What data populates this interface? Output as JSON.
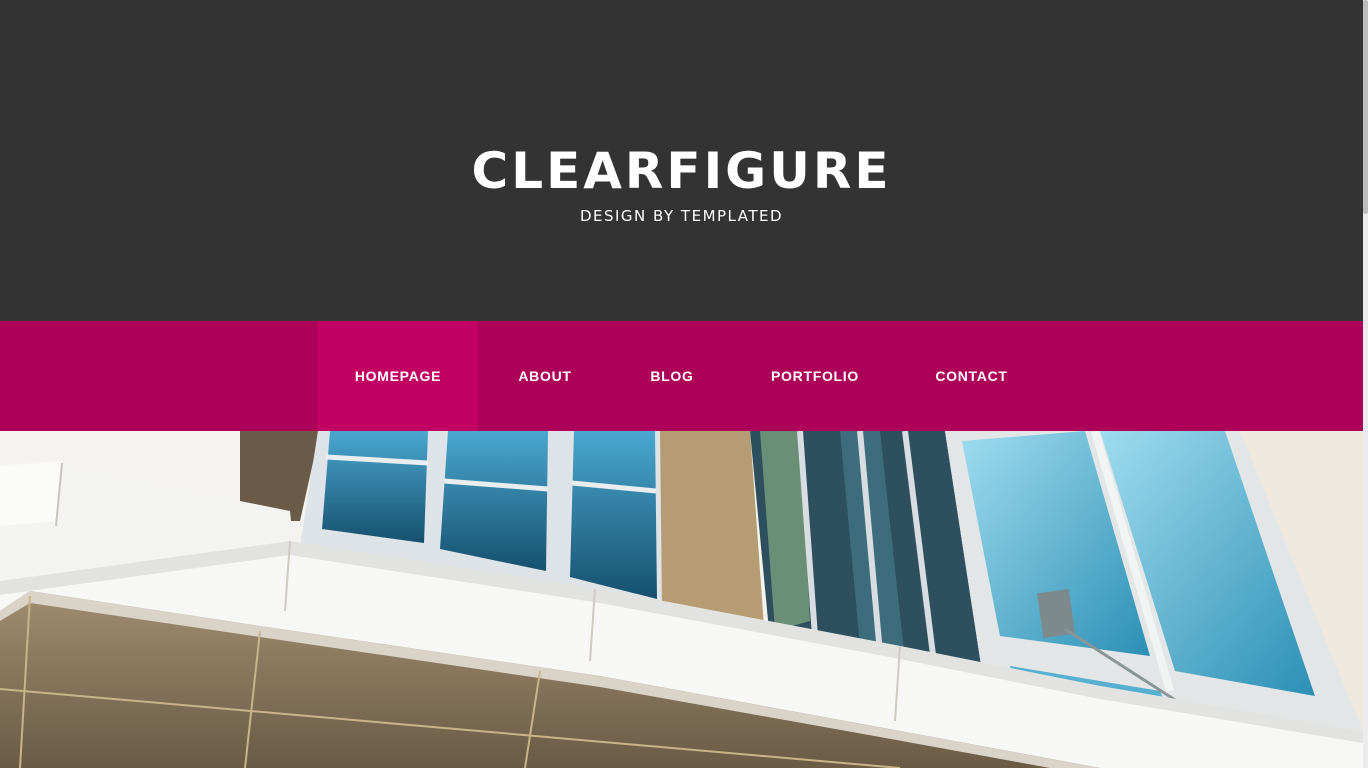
{
  "header": {
    "site_title": "CLEARFIGURE",
    "tagline": "DESIGN BY TEMPLATED"
  },
  "menu": {
    "items": [
      {
        "label": "HOMEPAGE",
        "active": true
      },
      {
        "label": "ABOUT",
        "active": false
      },
      {
        "label": "BLOG",
        "active": false
      },
      {
        "label": "PORTFOLIO",
        "active": false
      },
      {
        "label": "CONTACT",
        "active": false
      }
    ]
  },
  "colors": {
    "header_bg": "#333333",
    "menu_bg": "#ad0058",
    "menu_active_bg": "#c20064",
    "text": "#ffffff"
  }
}
